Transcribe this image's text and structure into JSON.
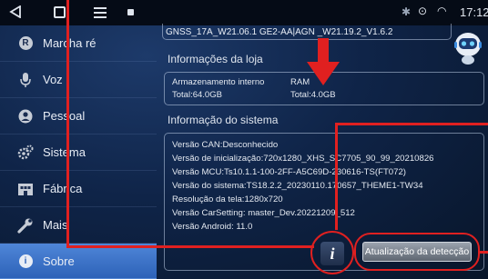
{
  "status_bar": {
    "time": "17:12",
    "icons": [
      "back-icon",
      "home-icon",
      "menu-icon",
      "notification-icon",
      "bluetooth-icon",
      "location-icon",
      "wifi-icon"
    ]
  },
  "sidebar": {
    "items": [
      {
        "label": "Marcha ré",
        "icon": "reverse-gear-icon",
        "icon_glyph": "R"
      },
      {
        "label": "Voz",
        "icon": "microphone-icon"
      },
      {
        "label": "Pessoal",
        "icon": "person-icon"
      },
      {
        "label": "Sistema",
        "icon": "gears-icon"
      },
      {
        "label": "Fábrica",
        "icon": "factory-icon"
      },
      {
        "label": "Mais",
        "icon": "wrench-icon"
      },
      {
        "label": "Sobre",
        "icon": "info-icon",
        "icon_glyph": "i",
        "active": true
      }
    ]
  },
  "main": {
    "gnss_version": "GNSS_17A_W21.06.1 GE2-AA|AGN      _W21.19.2_V1.6.2",
    "storage": {
      "title": "Informações da loja",
      "internal_label": "Armazenamento interno",
      "internal_total": "Total:64.0GB",
      "ram_label": "RAM",
      "ram_total": "Total:4.0GB"
    },
    "system": {
      "title": "Informação do sistema",
      "lines": [
        "Versão CAN:Desconhecido",
        "Versão de inicialização:720x1280_XHS_SC7705_90_99_20210826",
        "Versão MCU:Ts10.1.1-100-2FF-A5C69D-230616-TS(FT072)",
        "Versão do sistema:TS18.2.2_20230110.170657_THEME1-TW34",
        "Resolução da tela:1280x720",
        "Versão CarSetting: master_Dev.20221209_512",
        "Versão Android: 11.0"
      ]
    },
    "info_button_glyph": "i",
    "update_button_label": "Atualização da detecção"
  },
  "colors": {
    "highlight": "#e02020",
    "active_item": "#3a70c8",
    "background": "#0f2448"
  }
}
